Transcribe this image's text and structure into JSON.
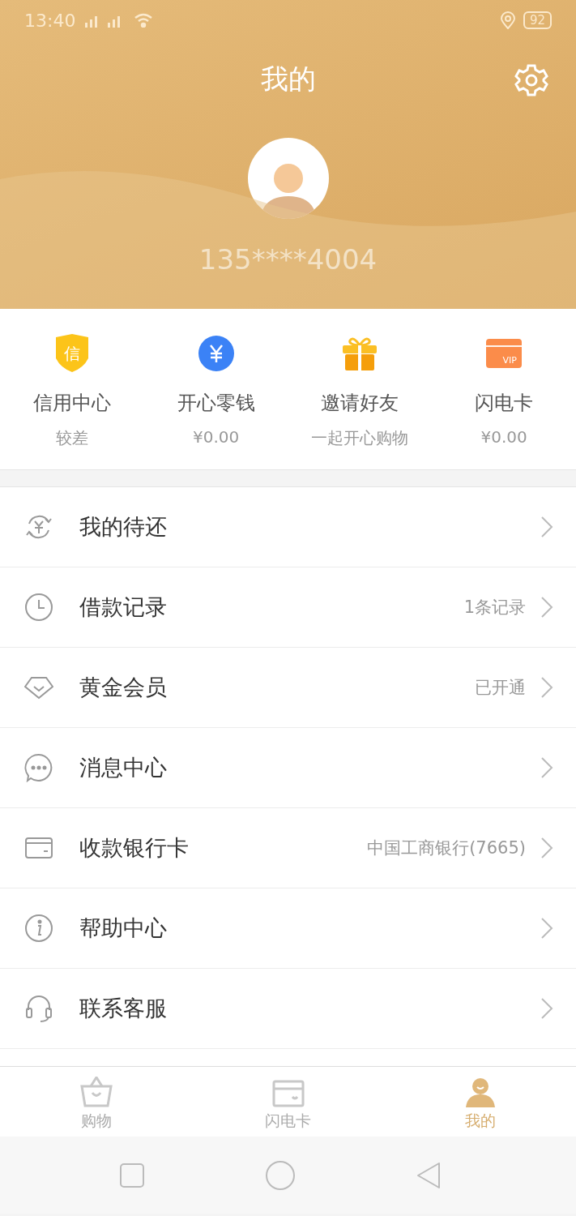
{
  "status_bar": {
    "time": "13:40",
    "battery": "92"
  },
  "header": {
    "title": "我的",
    "phone": "135****4004"
  },
  "quick_links": [
    {
      "kind": "credit",
      "icon_text": "信",
      "label": "信用中心",
      "sub": "较差"
    },
    {
      "kind": "wallet",
      "label": "开心零钱",
      "sub": "¥0.00"
    },
    {
      "kind": "gift",
      "label": "邀请好友",
      "sub": "一起开心购物"
    },
    {
      "kind": "vipcard",
      "icon_text": "VIP",
      "label": "闪电卡",
      "sub": "¥0.00"
    }
  ],
  "menu": [
    {
      "kind": "repay",
      "label": "我的待还"
    },
    {
      "kind": "clock",
      "label": "借款记录",
      "value": "1条记录"
    },
    {
      "kind": "diamond",
      "label": "黄金会员",
      "value": "已开通"
    },
    {
      "kind": "chat",
      "label": "消息中心"
    },
    {
      "kind": "card",
      "label": "收款银行卡",
      "value": "中国工商银行(7665)"
    },
    {
      "kind": "info",
      "label": "帮助中心"
    },
    {
      "kind": "headset",
      "label": "联系客服"
    }
  ],
  "tab_bar": [
    {
      "kind": "basket",
      "label": "购物",
      "selected": false
    },
    {
      "kind": "card",
      "label": "闪电卡",
      "selected": false
    },
    {
      "kind": "person",
      "label": "我的",
      "selected": true
    }
  ]
}
